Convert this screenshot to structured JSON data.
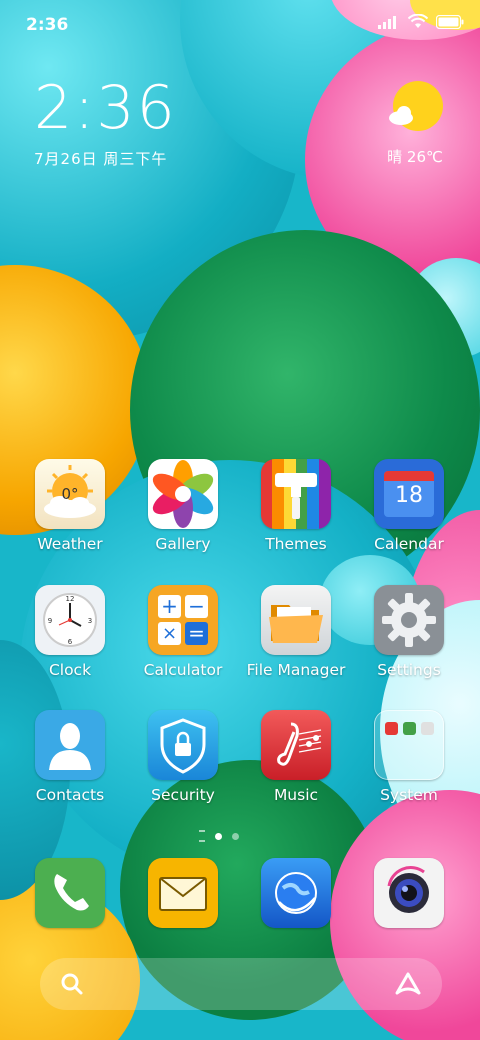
{
  "status_bar": {
    "time": "2:36",
    "signal_icon": "cellular-signal-icon",
    "wifi_icon": "wifi-icon",
    "battery_icon": "battery-icon"
  },
  "clock_widget": {
    "time": "2:36",
    "date": "7月26日 周三下午"
  },
  "weather_widget": {
    "icon": "sunny-cloud-icon",
    "text": "晴 26℃"
  },
  "apps": [
    {
      "label": "Weather",
      "icon": "weather-icon",
      "badge": "0°"
    },
    {
      "label": "Gallery",
      "icon": "gallery-icon"
    },
    {
      "label": "Themes",
      "icon": "themes-icon"
    },
    {
      "label": "Calendar",
      "icon": "calendar-icon",
      "badge": "18"
    },
    {
      "label": "Clock",
      "icon": "clock-icon"
    },
    {
      "label": "Calculator",
      "icon": "calculator-icon"
    },
    {
      "label": "File Manager",
      "icon": "file-manager-icon"
    },
    {
      "label": "Settings",
      "icon": "settings-icon"
    },
    {
      "label": "Contacts",
      "icon": "contacts-icon"
    },
    {
      "label": "Security",
      "icon": "security-icon"
    },
    {
      "label": "Music",
      "icon": "music-icon"
    },
    {
      "label": "System",
      "icon": "system-folder-icon"
    }
  ],
  "dock": [
    {
      "icon": "phone-icon"
    },
    {
      "icon": "messages-icon"
    },
    {
      "icon": "browser-icon"
    },
    {
      "icon": "camera-icon"
    }
  ],
  "page_indicator": {
    "pages": 2,
    "current": 1
  },
  "search_bar": {
    "search_icon": "search-icon",
    "assistant_icon": "assistant-icon"
  },
  "colors": {
    "wallpaper_teal": "#18b6c9",
    "wallpaper_green": "#0e8a4a",
    "wallpaper_pink": "#f0479a",
    "wallpaper_yellow": "#f7b500"
  }
}
